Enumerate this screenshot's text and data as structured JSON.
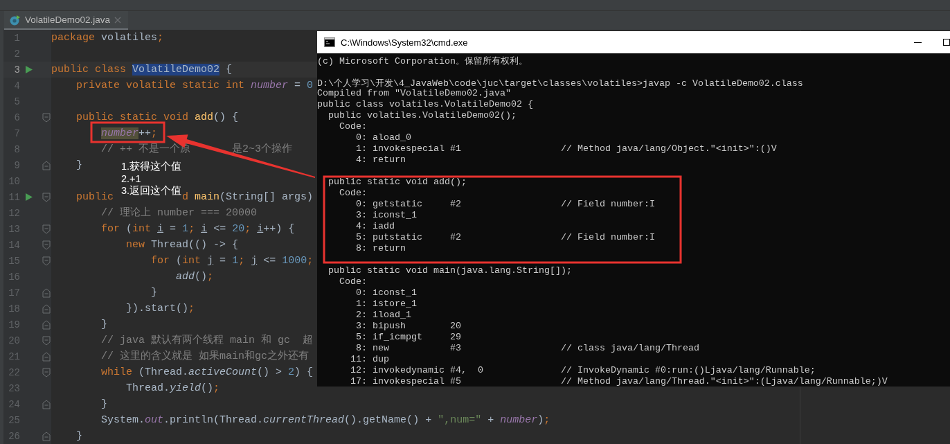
{
  "editor": {
    "tabs": [
      {
        "label": "VolatileDemo02.java",
        "selected": true
      }
    ],
    "lines": [
      {
        "number": "1",
        "current": false,
        "run": false,
        "tokens": [
          {
            "kind": "keyword",
            "text": "package"
          },
          {
            "kind": "plain",
            "text": " volatiles"
          },
          {
            "kind": "keyword",
            "text": ";"
          }
        ]
      },
      {
        "number": "2",
        "current": false,
        "run": false
      },
      {
        "number": "3",
        "current": true,
        "run": true,
        "tokens": [
          {
            "kind": "keyword",
            "text": "public class "
          },
          {
            "kind": "selection",
            "text": "VolatileDemo02"
          },
          {
            "kind": "plain",
            "text": " {"
          }
        ]
      },
      {
        "number": "4",
        "current": false,
        "run": false,
        "tokens": [
          {
            "kind": "keyword",
            "text": "    private volatile static int "
          },
          {
            "kind": "field",
            "text": "number"
          },
          {
            "kind": "plain",
            "text": " = "
          },
          {
            "kind": "number",
            "text": "0"
          }
        ]
      },
      {
        "number": "5",
        "current": false,
        "run": false
      },
      {
        "number": "6",
        "current": false,
        "run": false,
        "fold": {
          "kind": "open"
        },
        "tokens": [
          {
            "kind": "keyword",
            "text": "    public static void "
          },
          {
            "kind": "method",
            "text": "add"
          },
          {
            "kind": "plain",
            "text": "() {"
          }
        ]
      },
      {
        "number": "7",
        "current": false,
        "run": false,
        "tokens": [
          {
            "kind": "usage",
            "text": "        number"
          },
          {
            "kind": "plain",
            "text": "++"
          },
          {
            "kind": "keyword",
            "text": ";"
          }
        ]
      },
      {
        "number": "8",
        "current": false,
        "run": false,
        "parts": [
          [
            {
              "kind": "comment",
              "text": "        // ++ 不是一个原"
            }
          ],
          [
            {
              "kind": "comment",
              "text": "　　　　是2~3个操作"
            }
          ]
        ]
      },
      {
        "number": "9",
        "current": false,
        "run": false,
        "fold": {
          "kind": "close"
        },
        "tokens": [
          {
            "kind": "plain",
            "text": "    }"
          }
        ]
      },
      {
        "number": "10",
        "current": false,
        "run": false
      },
      {
        "number": "11",
        "current": false,
        "run": true,
        "fold": {
          "kind": "open"
        },
        "parts": [
          [
            {
              "kind": "keyword",
              "text": "    public"
            }
          ],
          [
            {
              "kind": "keyword",
              "text": "           d "
            },
            {
              "kind": "method",
              "text": "main"
            },
            {
              "kind": "plain",
              "text": "(String[] args)"
            }
          ]
        ]
      },
      {
        "number": "12",
        "current": false,
        "run": false,
        "tokens": [
          {
            "kind": "comment",
            "text": "        // 理论上 number === 20000"
          }
        ]
      },
      {
        "number": "13",
        "current": false,
        "run": false,
        "fold": {
          "kind": "open"
        },
        "tokens": [
          {
            "kind": "keyword",
            "text": "        for "
          },
          {
            "kind": "plain",
            "text": "("
          },
          {
            "kind": "keyword",
            "text": "int "
          },
          {
            "kind": "local",
            "text": "i"
          },
          {
            "kind": "plain",
            "text": " = "
          },
          {
            "kind": "number",
            "text": "1"
          },
          {
            "kind": "keyword",
            "text": "; "
          },
          {
            "kind": "local",
            "text": "i"
          },
          {
            "kind": "plain",
            "text": " <= "
          },
          {
            "kind": "number",
            "text": "20"
          },
          {
            "kind": "keyword",
            "text": "; "
          },
          {
            "kind": "local",
            "text": "i"
          },
          {
            "kind": "plain",
            "text": "++) {"
          }
        ]
      },
      {
        "number": "14",
        "current": false,
        "run": false,
        "fold": {
          "kind": "open"
        },
        "tokens": [
          {
            "kind": "keyword",
            "text": "            new "
          },
          {
            "kind": "plain",
            "text": "Thread(() -> {"
          }
        ]
      },
      {
        "number": "15",
        "current": false,
        "run": false,
        "fold": {
          "kind": "open"
        },
        "tokens": [
          {
            "kind": "keyword",
            "text": "                for "
          },
          {
            "kind": "plain",
            "text": "("
          },
          {
            "kind": "keyword",
            "text": "int "
          },
          {
            "kind": "local",
            "text": "j"
          },
          {
            "kind": "plain",
            "text": " = "
          },
          {
            "kind": "number",
            "text": "1"
          },
          {
            "kind": "keyword",
            "text": "; "
          },
          {
            "kind": "local",
            "text": "j"
          },
          {
            "kind": "plain",
            "text": " <= "
          },
          {
            "kind": "number",
            "text": "1000"
          },
          {
            "kind": "keyword",
            "text": ";"
          }
        ]
      },
      {
        "number": "16",
        "current": false,
        "run": false,
        "tokens": [
          {
            "kind": "call",
            "text": "                    add"
          },
          {
            "kind": "plain",
            "text": "()"
          },
          {
            "kind": "keyword",
            "text": ";"
          }
        ]
      },
      {
        "number": "17",
        "current": false,
        "run": false,
        "fold": {
          "kind": "close"
        },
        "tokens": [
          {
            "kind": "plain",
            "text": "                }"
          }
        ]
      },
      {
        "number": "18",
        "current": false,
        "run": false,
        "fold": {
          "kind": "close"
        },
        "tokens": [
          {
            "kind": "plain",
            "text": "            }).start()"
          },
          {
            "kind": "keyword",
            "text": ";"
          }
        ]
      },
      {
        "number": "19",
        "current": false,
        "run": false,
        "fold": {
          "kind": "close"
        },
        "tokens": [
          {
            "kind": "plain",
            "text": "        }"
          }
        ]
      },
      {
        "number": "20",
        "current": false,
        "run": false,
        "fold": {
          "kind": "open"
        },
        "tokens": [
          {
            "kind": "comment",
            "text": "        // java 默认有两个线程 main 和 gc  超"
          }
        ]
      },
      {
        "number": "21",
        "current": false,
        "run": false,
        "fold": {
          "kind": "close"
        },
        "tokens": [
          {
            "kind": "comment",
            "text": "        // 这里的含义就是 如果main和gc之外还有"
          }
        ]
      },
      {
        "number": "22",
        "current": false,
        "run": false,
        "fold": {
          "kind": "open"
        },
        "tokens": [
          {
            "kind": "keyword",
            "text": "        while "
          },
          {
            "kind": "plain",
            "text": "(Thread."
          },
          {
            "kind": "call",
            "text": "activeCount"
          },
          {
            "kind": "plain",
            "text": "() > "
          },
          {
            "kind": "number",
            "text": "2"
          },
          {
            "kind": "plain",
            "text": ") {"
          }
        ]
      },
      {
        "number": "23",
        "current": false,
        "run": false,
        "tokens": [
          {
            "kind": "plain",
            "text": "            Thread."
          },
          {
            "kind": "call",
            "text": "yield"
          },
          {
            "kind": "plain",
            "text": "()"
          },
          {
            "kind": "keyword",
            "text": ";"
          }
        ]
      },
      {
        "number": "24",
        "current": false,
        "run": false,
        "fold": {
          "kind": "close"
        },
        "tokens": [
          {
            "kind": "plain",
            "text": "        }"
          }
        ]
      },
      {
        "number": "25",
        "current": false,
        "run": false,
        "tokens": [
          {
            "kind": "plain",
            "text": "        System."
          },
          {
            "kind": "field",
            "text": "out"
          },
          {
            "kind": "plain",
            "text": ".println(Thread."
          },
          {
            "kind": "call",
            "text": "currentThread"
          },
          {
            "kind": "plain",
            "text": "().getName() + "
          },
          {
            "kind": "string",
            "text": "\",num=\""
          },
          {
            "kind": "plain",
            "text": " + "
          },
          {
            "kind": "field",
            "text": "number"
          },
          {
            "kind": "plain",
            "text": ")"
          },
          {
            "kind": "keyword",
            "text": ";"
          }
        ]
      },
      {
        "number": "26",
        "current": false,
        "run": false,
        "fold": {
          "kind": "close"
        },
        "tokens": [
          {
            "kind": "plain",
            "text": "    }"
          }
        ]
      }
    ]
  },
  "terminal": {
    "title": "C:\\Windows\\System32\\cmd.exe",
    "blocks": [
      [
        "(c) Microsoft Corporation。保留所有权利。"
      ],
      [
        "D:\\个人学习\\开发\\4_JavaWeb\\code\\juc\\target\\classes\\volatiles>javap -c VolatileDemo02.class",
        "Compiled from \"VolatileDemo02.java\"",
        "public class volatiles.VolatileDemo02 {",
        "  public volatiles.VolatileDemo02();",
        "    Code:",
        "       0: aload_0",
        "       1: invokespecial #1                  // Method java/lang/Object.\"<init>\":()V",
        "       4: return"
      ],
      [
        "  public static void add();",
        "    Code:",
        "       0: getstatic     #2                  // Field number:I",
        "       3: iconst_1",
        "       4: iadd",
        "       5: putstatic     #2                  // Field number:I",
        "       8: return"
      ],
      [
        "  public static void main(java.lang.String[]);",
        "    Code:",
        "       0: iconst_1",
        "       1: istore_1",
        "       2: iload_1",
        "       3: bipush        20",
        "       5: if_icmpgt     29",
        "       8: new           #3                  // class java/lang/Thread",
        "      11: dup",
        "      12: invokedynamic #4,  0              // InvokeDynamic #0:run:()Ljava/lang/Runnable;",
        "      17: invokespecial #5                  // Method java/lang/Thread.\"<init>\":(Ljava/lang/Runnable;)V"
      ]
    ]
  },
  "annotation": {
    "steps": [
      "1.获得这个值",
      "2.+1",
      "3.返回这个值"
    ]
  }
}
